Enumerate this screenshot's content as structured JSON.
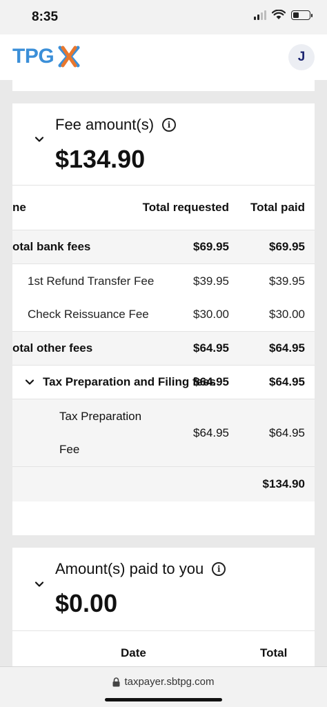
{
  "status_bar": {
    "time": "8:35",
    "battery_level": 0.35
  },
  "header": {
    "logo_text": "TPG",
    "avatar_initial": "J",
    "logo_colors": {
      "text": "#3b8fd8",
      "mark_primary": "#e8772e",
      "mark_secondary": "#3b8fd8"
    }
  },
  "fee_card": {
    "title": "Fee amount(s)",
    "amount": "$134.90",
    "columns": {
      "name": "ne",
      "requested": "Total requested",
      "paid": "Total paid"
    },
    "rows": {
      "bank_total": {
        "name": "otal bank fees",
        "requested": "$69.95",
        "paid": "$69.95"
      },
      "refund_transfer": {
        "name": "1st Refund Transfer Fee",
        "requested": "$39.95",
        "paid": "$39.95"
      },
      "check_reissuance": {
        "name": "Check Reissuance Fee",
        "requested": "$30.00",
        "paid": "$30.00"
      },
      "other_total": {
        "name": "otal other fees",
        "requested": "$64.95",
        "paid": "$64.95"
      },
      "tax_prep_group": {
        "name": "Tax Preparation and Filing fees",
        "requested": "$64.95",
        "paid": "$64.95"
      },
      "tax_prep_fee": {
        "name": "Tax Preparation Fee",
        "requested": "$64.95",
        "paid": "$64.95"
      },
      "grand_total": {
        "paid": "$134.90"
      }
    }
  },
  "paid_card": {
    "title": "Amount(s) paid to you",
    "amount": "$0.00",
    "columns": {
      "date": "Date",
      "total": "Total"
    }
  },
  "browser": {
    "url": "taxpayer.sbtpg.com"
  }
}
